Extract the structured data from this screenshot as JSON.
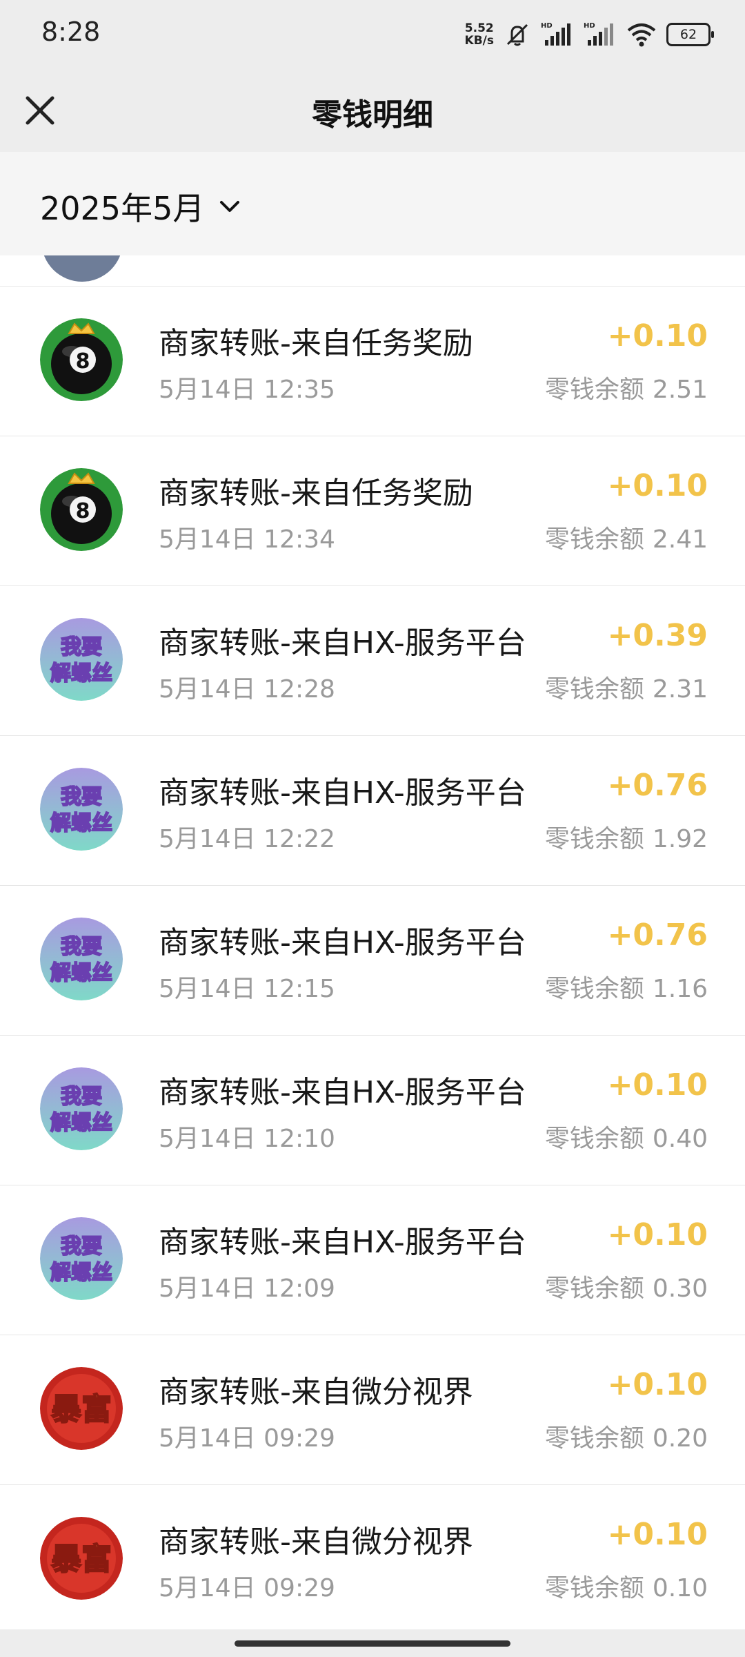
{
  "status_bar": {
    "time": "8:28",
    "net_speed_value": "5.52",
    "net_speed_unit": "KB/s",
    "battery": "62",
    "icons": [
      "mute-icon",
      "signal-hd-icon",
      "signal-hd-icon",
      "wifi-icon",
      "battery-icon"
    ]
  },
  "header": {
    "title": "零钱明细",
    "close_icon": "close-icon"
  },
  "filter": {
    "month": "2025年5月",
    "icon": "chevron-down-icon"
  },
  "colors": {
    "amount": "#f2c34a",
    "secondary_text": "#9a9a9a",
    "background": "#ededed"
  },
  "transactions": [
    {
      "title": "商家转账-来自任务奖励",
      "time": "5月14日 12:35",
      "amount": "+0.10",
      "balance_label": "零钱余额",
      "balance": "2.51",
      "avatar": "billiard-8-ball"
    },
    {
      "title": "商家转账-来自任务奖励",
      "time": "5月14日 12:34",
      "amount": "+0.10",
      "balance_label": "零钱余额",
      "balance": "2.41",
      "avatar": "billiard-8-ball"
    },
    {
      "title": "商家转账-来自HX-服务平台",
      "time": "5月14日 12:28",
      "amount": "+0.39",
      "balance_label": "零钱余额",
      "balance": "2.31",
      "avatar": "screw-game",
      "avatar_text": [
        "我要",
        "解螺丝"
      ]
    },
    {
      "title": "商家转账-来自HX-服务平台",
      "time": "5月14日 12:22",
      "amount": "+0.76",
      "balance_label": "零钱余额",
      "balance": "1.92",
      "avatar": "screw-game",
      "avatar_text": [
        "我要",
        "解螺丝"
      ]
    },
    {
      "title": "商家转账-来自HX-服务平台",
      "time": "5月14日 12:15",
      "amount": "+0.76",
      "balance_label": "零钱余额",
      "balance": "1.16",
      "avatar": "screw-game",
      "avatar_text": [
        "我要",
        "解螺丝"
      ]
    },
    {
      "title": "商家转账-来自HX-服务平台",
      "time": "5月14日 12:10",
      "amount": "+0.10",
      "balance_label": "零钱余额",
      "balance": "0.40",
      "avatar": "screw-game",
      "avatar_text": [
        "我要",
        "解螺丝"
      ]
    },
    {
      "title": "商家转账-来自HX-服务平台",
      "time": "5月14日 12:09",
      "amount": "+0.10",
      "balance_label": "零钱余额",
      "balance": "0.30",
      "avatar": "screw-game",
      "avatar_text": [
        "我要",
        "解螺丝"
      ]
    },
    {
      "title": "商家转账-来自微分视界",
      "time": "5月14日 09:29",
      "amount": "+0.10",
      "balance_label": "零钱余额",
      "balance": "0.20",
      "avatar": "baofu",
      "avatar_text": [
        "暴富"
      ]
    },
    {
      "title": "商家转账-来自微分视界",
      "time": "5月14日 09:29",
      "amount": "+0.10",
      "balance_label": "零钱余额",
      "balance": "0.10",
      "avatar": "baofu",
      "avatar_text": [
        "暴富"
      ]
    }
  ]
}
